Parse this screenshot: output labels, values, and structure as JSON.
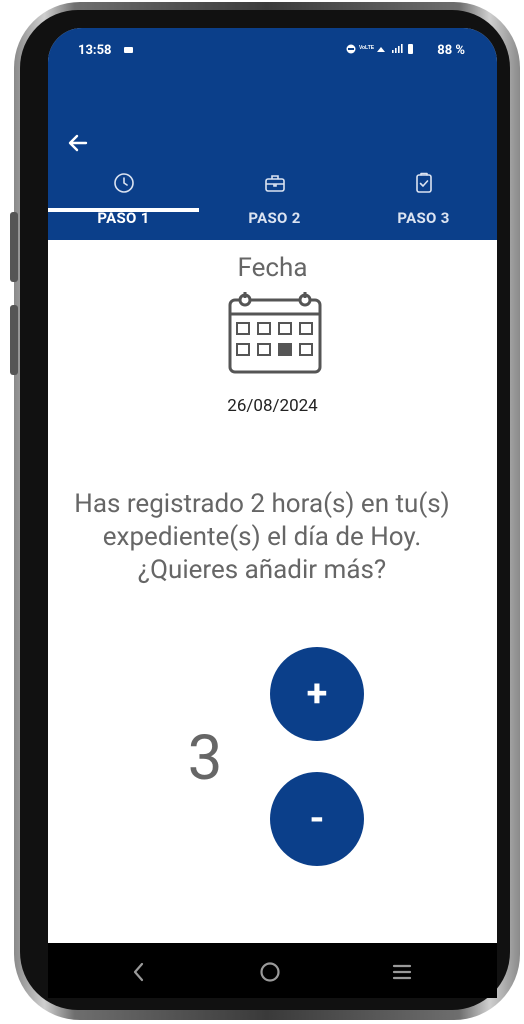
{
  "status_bar": {
    "time": "13:58",
    "battery": "88 %"
  },
  "tabs": [
    {
      "label": "PASO 1",
      "icon": "clock-icon",
      "active": true
    },
    {
      "label": "PASO 2",
      "icon": "briefcase-icon",
      "active": false
    },
    {
      "label": "PASO 3",
      "icon": "clipboard-check-icon",
      "active": false
    }
  ],
  "content": {
    "fecha_label": "Fecha",
    "date_value": "26/08/2024",
    "message_line1": "Has registrado 2 hora(s) en tu(s)",
    "message_line2": "expediente(s) el día de Hoy.",
    "message_line3": "¿Quieres añadir más?",
    "counter_value": "3",
    "plus_label": "+",
    "minus_label": "-"
  },
  "colors": {
    "primary": "#0b3f8a",
    "text_gray": "#666666"
  }
}
